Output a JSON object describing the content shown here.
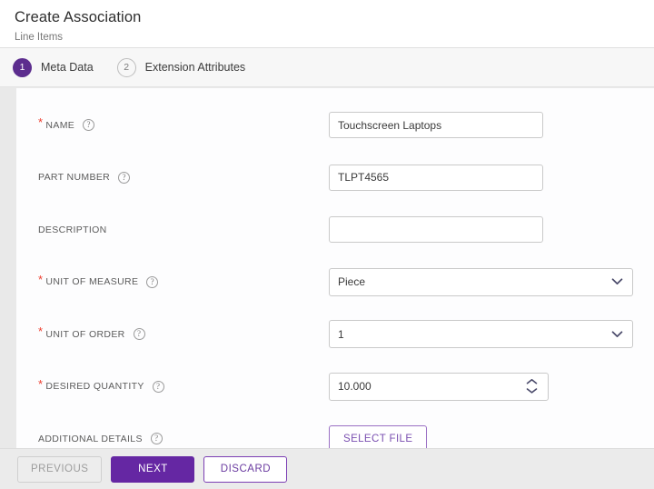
{
  "header": {
    "title": "Create Association",
    "subtitle": "Line Items"
  },
  "wizard": {
    "steps": [
      {
        "number": "1",
        "label": "Meta Data",
        "state": "active"
      },
      {
        "number": "2",
        "label": "Extension Attributes",
        "state": "inactive"
      }
    ]
  },
  "form": {
    "help_glyph": "?",
    "fields": [
      {
        "label": "NAME",
        "required": true,
        "control": "text",
        "value": "Touchscreen Laptops",
        "placeholder": ""
      },
      {
        "label": "PART NUMBER",
        "required": false,
        "control": "text",
        "value": "TLPT4565",
        "placeholder": ""
      },
      {
        "label": "DESCRIPTION",
        "required": false,
        "control": "text",
        "value": "",
        "placeholder": "",
        "has_help": false
      },
      {
        "label": "UNIT OF MEASURE",
        "required": true,
        "control": "select",
        "value": "Piece"
      },
      {
        "label": "UNIT OF ORDER",
        "required": true,
        "control": "select",
        "value": "1"
      },
      {
        "label": "DESIRED QUANTITY",
        "required": true,
        "control": "number",
        "value": "10.000"
      },
      {
        "label": "ADDITIONAL DETAILS",
        "required": false,
        "control": "file",
        "button_label": "SELECT FILE"
      }
    ]
  },
  "footer": {
    "previous_label": "PREVIOUS",
    "next_label": "NEXT",
    "discard_label": "DISCARD"
  },
  "colors": {
    "brand_purple": "#6527a3",
    "step_active": "#5c2d8e",
    "required_star": "#ee3d2e",
    "footer_bg": "#ebebeb"
  }
}
